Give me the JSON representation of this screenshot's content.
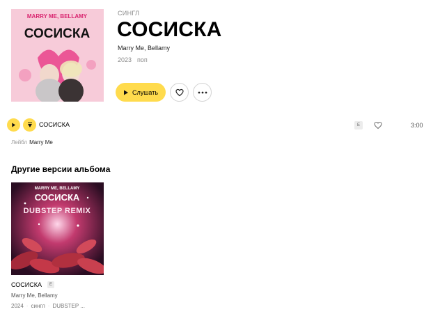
{
  "album": {
    "type_label": "СИНГЛ",
    "title": "СОСИСКА",
    "artists": "Marry Me, Bellamy",
    "year": "2023",
    "genre": "поп",
    "cover_band_text": "MARRY ME, BELLAMY",
    "cover_title_text": "СОСИСКА"
  },
  "actions": {
    "listen_label": "Слушать",
    "like_icon": "heart-icon",
    "more_icon": "ellipsis-icon"
  },
  "track": {
    "title": "СОСИСКА",
    "explicit_badge": "E",
    "duration": "3:00"
  },
  "label": {
    "prefix": "Лейбл",
    "value": "Marry Me"
  },
  "other_versions": {
    "section_title": "Другие версии альбома",
    "items": [
      {
        "title": "СОСИСКА",
        "explicit_badge": "E",
        "artists": "Marry Me, Bellamy",
        "year": "2024",
        "type": "сингл",
        "genre": "DUBSTEP ...",
        "cover_band_text": "MARRY ME, BELLAMY",
        "cover_title_text": "СОСИСКА",
        "cover_subtitle_text": "DUBSTEP REMIX"
      }
    ]
  },
  "colors": {
    "accent": "#ffdb4d",
    "muted_text": "#8a8a8a"
  }
}
